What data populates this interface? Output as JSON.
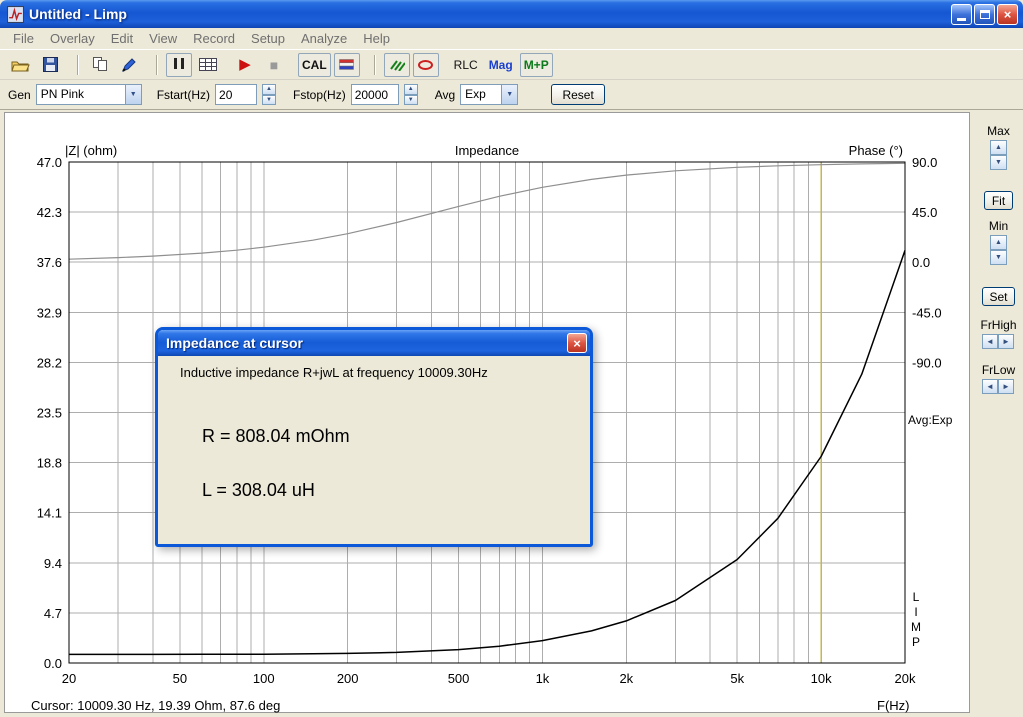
{
  "window": {
    "title": "Untitled - Limp"
  },
  "menu": {
    "items": [
      "File",
      "Overlay",
      "Edit",
      "View",
      "Record",
      "Setup",
      "Analyze",
      "Help"
    ]
  },
  "icons": {
    "up": "▲",
    "down": "▼",
    "left": "◄",
    "right": "►",
    "dropdown": "▼",
    "close": "×",
    "play": "▶",
    "stop": "■"
  },
  "toolbar": {
    "cal_label": "CAL",
    "rlc_label": "RLC",
    "mag_label": "Mag",
    "mp_label": "M+P"
  },
  "genbar": {
    "gen_label": "Gen",
    "gen_value": "PN Pink",
    "fstart_label": "Fstart(Hz)",
    "fstart_value": "20",
    "fstop_label": "Fstop(Hz)",
    "fstop_value": "20000",
    "avg_label": "Avg",
    "avg_value": "Exp",
    "reset_label": "Reset"
  },
  "side_panel": {
    "max_label": "Max",
    "fit_label": "Fit",
    "min_label": "Min",
    "set_label": "Set",
    "frhigh_label": "FrHigh",
    "frlow_label": "FrLow"
  },
  "chart": {
    "cursor_status": "Cursor: 10009.30 Hz, 19.39 Ohm, 87.6 deg",
    "avg_mode": "Avg:Exp",
    "limp_vertical": [
      "L",
      "I",
      "M",
      "P"
    ]
  },
  "dialog": {
    "title": "Impedance at cursor",
    "line1": "Inductive impedance R+jwL at frequency 10009.30Hz",
    "r_line": "R = 808.04 mOhm",
    "l_line": "L = 308.04 uH"
  },
  "chart_data": {
    "type": "line",
    "title": "Impedance",
    "x_axis": {
      "label": "F(Hz)",
      "scale": "log",
      "min": 20,
      "max": 20000,
      "tick_labels": [
        "20",
        "50",
        "100",
        "200",
        "500",
        "1k",
        "2k",
        "5k",
        "10k",
        "20k"
      ],
      "tick_values": [
        20,
        50,
        100,
        200,
        500,
        1000,
        2000,
        5000,
        10000,
        20000
      ]
    },
    "y_left": {
      "label": "|Z| (ohm)",
      "min": 0,
      "max": 47,
      "tick_labels": [
        "47.0",
        "42.3",
        "37.6",
        "32.9",
        "28.2",
        "23.5",
        "18.8",
        "14.1",
        "9.4",
        "4.7",
        "0.0"
      ]
    },
    "y_right": {
      "label": "Phase (°)",
      "top_value": 90,
      "deg_per_division": 45,
      "tick_labels": [
        "90.0",
        "45.0",
        "0.0",
        "-45.0",
        "-90.0"
      ]
    },
    "series": [
      {
        "name": "impedance",
        "unit": "ohm",
        "color": "#000000",
        "freq_hz": [
          20,
          30,
          40,
          60,
          80,
          100,
          150,
          200,
          300,
          500,
          700,
          1000,
          1500,
          2000,
          3000,
          5000,
          7000,
          10000,
          14000,
          20000
        ],
        "values": [
          0.81,
          0.81,
          0.81,
          0.82,
          0.82,
          0.83,
          0.86,
          0.9,
          0.99,
          1.26,
          1.58,
          2.1,
          3.01,
          3.95,
          5.86,
          9.71,
          13.57,
          19.37,
          27.1,
          38.71
        ]
      },
      {
        "name": "phase",
        "unit": "deg",
        "color": "#8f8f8f",
        "freq_hz": [
          20,
          30,
          40,
          60,
          80,
          100,
          150,
          200,
          300,
          500,
          700,
          1000,
          1500,
          2000,
          3000,
          5000,
          7000,
          10000,
          14000,
          20000
        ],
        "values": [
          2.7,
          4.1,
          5.5,
          8.2,
          10.8,
          13.5,
          19.8,
          25.6,
          35.7,
          50.1,
          59.2,
          67.3,
          74.4,
          78.2,
          82.1,
          85.2,
          86.6,
          87.6,
          88.3,
          88.8
        ]
      }
    ],
    "cursor": {
      "freq_hz": 10009.3,
      "impedance_ohm": 19.39,
      "phase_deg": 87.6,
      "line_color": "#c6b84a"
    },
    "grid": true,
    "plot_bg": "#ffffff",
    "fit": {
      "R_mohm": 808.04,
      "L_uH": 308.04
    }
  }
}
